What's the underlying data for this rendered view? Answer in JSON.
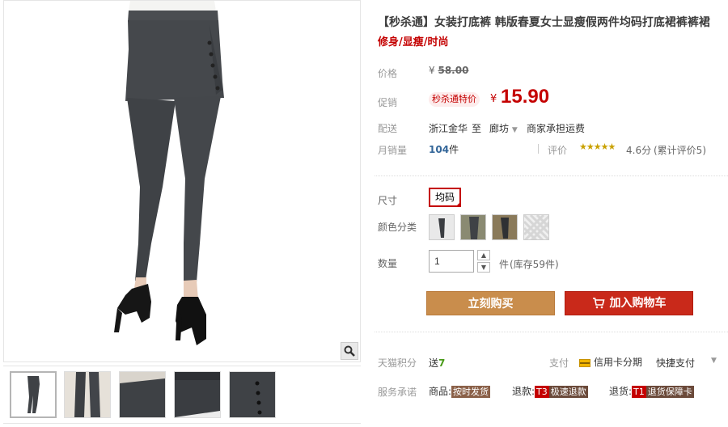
{
  "product": {
    "title": "【秒杀通】女装打底裤 韩版春夏女士显瘦假两件均码打底裙裤裤裙",
    "subtitle": "修身/显瘦/时尚"
  },
  "price": {
    "label": "价格",
    "currency": "¥",
    "original": "58.00"
  },
  "promo": {
    "label": "促销",
    "tag": "秒杀通特价",
    "currency": "¥",
    "price": "15.90"
  },
  "delivery": {
    "label": "配送",
    "from": "浙江金华",
    "to_word": "至",
    "to": "廊坊",
    "fee": "商家承担运费"
  },
  "sales": {
    "label": "月销量",
    "count": "104",
    "unit": "件",
    "rating_label": "评价",
    "stars": 4.6,
    "score": "4.6分",
    "reviews": "(累计评价5)"
  },
  "options": {
    "size_label": "尺寸",
    "size_value": "均码",
    "color_label": "颜色分类",
    "qty_label": "数量",
    "qty_value": "1",
    "qty_unit": "件",
    "stock": "(库存59件)"
  },
  "actions": {
    "buy_now": "立刻购买",
    "add_cart": "加入购物车"
  },
  "points": {
    "label": "天猫积分",
    "give": "送",
    "value": "7",
    "pay_label": "支付",
    "credit": "信用卡分期",
    "quick": "快捷支付"
  },
  "service": {
    "label": "服务承诺",
    "goods": "商品:",
    "goods_tag": "按时发货",
    "refund": "退款:",
    "refund_tag1": "T3",
    "refund_tag2": "极速退款",
    "return": "退货:",
    "return_tag1": "T1",
    "return_tag2": "退货保障卡"
  },
  "colors": {
    "accent": "#c40000",
    "buy": "#c98d4c",
    "cart": "#c9291a",
    "legging": "#3f4246"
  },
  "icons": [
    "zoom-icon",
    "up-arrow-icon",
    "down-arrow-icon",
    "cart-icon",
    "credit-card-icon",
    "chevron-down-icon",
    "star-icon"
  ]
}
